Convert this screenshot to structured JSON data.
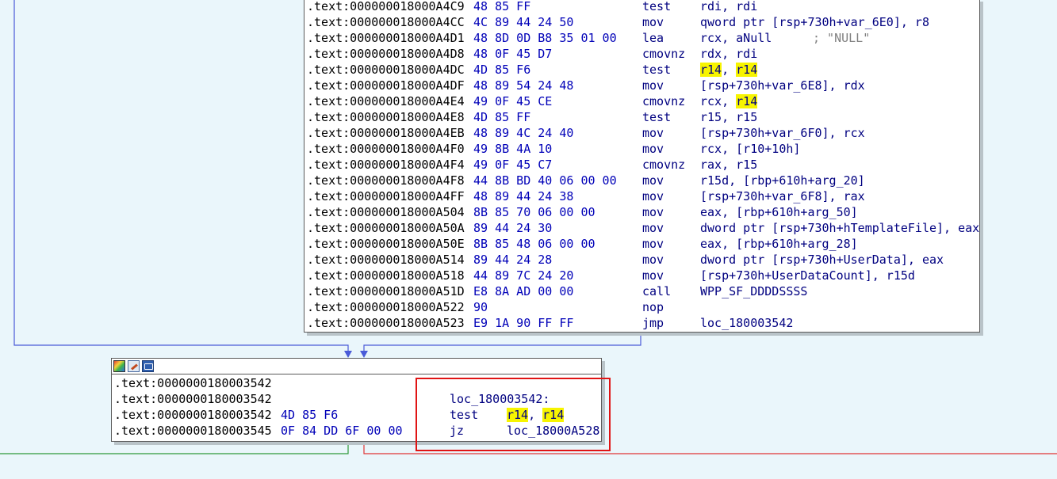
{
  "colors": {
    "background": "#eaf6fb",
    "edge_normal": "#4a5bd8",
    "edge_true": "#2f9a3a",
    "edge_false": "#e03535",
    "highlight": "#f7f400",
    "annotation": "#e01414"
  },
  "top_block": {
    "lines": [
      {
        "addr": ".text:000000018000A4C9",
        "bytes": "48 85 FF",
        "mnemonic": "test",
        "op_a": "rdi, rdi"
      },
      {
        "addr": ".text:000000018000A4CC",
        "bytes": "4C 89 44 24 50",
        "mnemonic": "mov",
        "op_a": "qword ptr [rsp+730h+var_6E0], r8"
      },
      {
        "addr": ".text:000000018000A4D1",
        "bytes": "48 8D 0D B8 35 01 00",
        "mnemonic": "lea",
        "op_a": "rcx, aNull",
        "comment": "; \"NULL\""
      },
      {
        "addr": ".text:000000018000A4D8",
        "bytes": "48 0F 45 D7",
        "mnemonic": "cmovnz",
        "op_a": "rdx, rdi"
      },
      {
        "addr": ".text:000000018000A4DC",
        "bytes": "4D 85 F6",
        "mnemonic": "test",
        "op_hl1": "r14",
        "op_sep": ", ",
        "op_hl2": "r14"
      },
      {
        "addr": ".text:000000018000A4DF",
        "bytes": "48 89 54 24 48",
        "mnemonic": "mov",
        "op_a": "[rsp+730h+var_6E8], rdx"
      },
      {
        "addr": ".text:000000018000A4E4",
        "bytes": "49 0F 45 CE",
        "mnemonic": "cmovnz",
        "op_a": "rcx, ",
        "op_hl2": "r14"
      },
      {
        "addr": ".text:000000018000A4E8",
        "bytes": "4D 85 FF",
        "mnemonic": "test",
        "op_a": "r15, r15"
      },
      {
        "addr": ".text:000000018000A4EB",
        "bytes": "48 89 4C 24 40",
        "mnemonic": "mov",
        "op_a": "[rsp+730h+var_6F0], rcx"
      },
      {
        "addr": ".text:000000018000A4F0",
        "bytes": "49 8B 4A 10",
        "mnemonic": "mov",
        "op_a": "rcx, [r10+10h]"
      },
      {
        "addr": ".text:000000018000A4F4",
        "bytes": "49 0F 45 C7",
        "mnemonic": "cmovnz",
        "op_a": "rax, r15"
      },
      {
        "addr": ".text:000000018000A4F8",
        "bytes": "44 8B BD 40 06 00 00",
        "mnemonic": "mov",
        "op_a": "r15d, [rbp+610h+arg_20]"
      },
      {
        "addr": ".text:000000018000A4FF",
        "bytes": "48 89 44 24 38",
        "mnemonic": "mov",
        "op_a": "[rsp+730h+var_6F8], rax"
      },
      {
        "addr": ".text:000000018000A504",
        "bytes": "8B 85 70 06 00 00",
        "mnemonic": "mov",
        "op_a": "eax, [rbp+610h+arg_50]"
      },
      {
        "addr": ".text:000000018000A50A",
        "bytes": "89 44 24 30",
        "mnemonic": "mov",
        "op_a": "dword ptr [rsp+730h+hTemplateFile], eax"
      },
      {
        "addr": ".text:000000018000A50E",
        "bytes": "8B 85 48 06 00 00",
        "mnemonic": "mov",
        "op_a": "eax, [rbp+610h+arg_28]"
      },
      {
        "addr": ".text:000000018000A514",
        "bytes": "89 44 24 28",
        "mnemonic": "mov",
        "op_a": "dword ptr [rsp+730h+UserData], eax"
      },
      {
        "addr": ".text:000000018000A518",
        "bytes": "44 89 7C 24 20",
        "mnemonic": "mov",
        "op_a": "[rsp+730h+UserDataCount], r15d"
      },
      {
        "addr": ".text:000000018000A51D",
        "bytes": "E8 8A AD 00 00",
        "mnemonic": "call",
        "op_a": "WPP_SF_DDDDSSSS"
      },
      {
        "addr": ".text:000000018000A522",
        "bytes": "90",
        "mnemonic": "nop",
        "op_a": ""
      },
      {
        "addr": ".text:000000018000A523",
        "bytes": "E9 1A 90 FF FF",
        "mnemonic": "jmp",
        "op_a": "loc_180003542"
      }
    ]
  },
  "bottom_block": {
    "header_icons": [
      "palette-icon",
      "edit-node-icon",
      "graph-overview-icon"
    ],
    "lines": [
      {
        "addr": ".text:0000000180003542",
        "bytes": "",
        "mnemonic": "",
        "op_a": ""
      },
      {
        "addr": ".text:0000000180003542",
        "bytes": "",
        "label": "loc_180003542:"
      },
      {
        "addr": ".text:0000000180003542",
        "bytes": "4D 85 F6",
        "mnemonic": "test",
        "op_hl1": "r14",
        "op_sep": ", ",
        "op_hl2": "r14"
      },
      {
        "addr": ".text:0000000180003545",
        "bytes": "0F 84 DD 6F 00 00",
        "mnemonic": "jz",
        "op_a": "loc_18000A528"
      }
    ]
  }
}
